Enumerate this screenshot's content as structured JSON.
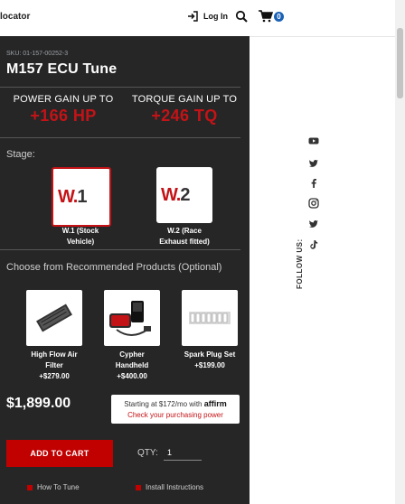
{
  "header": {
    "partial_label": "locator",
    "login_label": "Log In",
    "cart_count": "0"
  },
  "product": {
    "sku": "SKU: 01-157-00252-3",
    "title": "M157 ECU Tune",
    "power_label": "POWER GAIN UP TO",
    "power_value": "+166 HP",
    "torque_label": "TORQUE GAIN UP TO",
    "torque_value": "+246 TQ",
    "stage_label": "Stage:",
    "stages": [
      {
        "logo_w": "W.",
        "logo_num": "1",
        "caption_line1": "W.1 (Stock",
        "caption_line2": "Vehicle)",
        "selected": true
      },
      {
        "logo_w": "W.",
        "logo_num": "2",
        "caption_line1": "W.2 (Race",
        "caption_line2": "Exhaust fitted)",
        "selected": false
      }
    ],
    "recommended_title": "Choose from Recommended Products (Optional)",
    "recommended": [
      {
        "name_line1": "High Flow Air",
        "name_line2": "Filter",
        "price": "+$279.00"
      },
      {
        "name_line1": "Cypher",
        "name_line2": "Handheld",
        "price": "+$400.00"
      },
      {
        "name_line1": "Spark Plug Set",
        "name_line2": "",
        "price": "+$199.00"
      }
    ],
    "price": "$1,899.00",
    "affirm": {
      "line1_prefix": "Starting at $172/mo with",
      "logo": "affirm",
      "line2": "Check your purchasing power"
    },
    "add_to_cart": "ADD TO CART",
    "qty_label": "QTY:",
    "qty_value": "1",
    "how_to_tune": "How To Tune",
    "install_instructions": "Install Instructions"
  },
  "social": {
    "follow_label": "FOLLOW US:",
    "icons": [
      "youtube-icon",
      "twitter-icon",
      "facebook-icon",
      "instagram-icon",
      "twitter-icon",
      "tiktok-icon"
    ]
  },
  "colors": {
    "accent_red": "#c41317",
    "panel_bg": "#262626",
    "badge_blue": "#1a61b5"
  }
}
